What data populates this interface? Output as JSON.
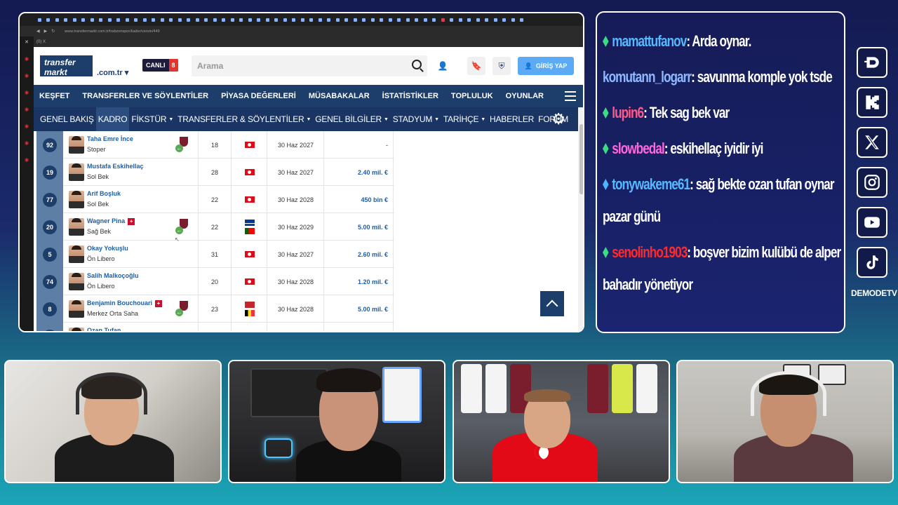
{
  "browser": {
    "url": "www.transfermarkt.com.tr/trabzonspor/kader/verein/449",
    "bookmarks_label": "(0) X",
    "site": {
      "logo_line1": "transfer",
      "logo_line2": "markt",
      "domain": ".com.tr ▾",
      "live_label": "CANLI",
      "live_count": "8",
      "search_placeholder": "Arama",
      "login_label": "GİRİŞ YAP",
      "main_nav": [
        "KEŞFET",
        "TRANSFERLER VE SÖYLENTİLER",
        "PİYASA DEĞERLERİ",
        "MÜSABAKALAR",
        "İSTATİSTİKLER",
        "TOPLULUK",
        "OYUNLAR"
      ],
      "sub_nav": [
        {
          "label": "GENEL BAKIŞ",
          "caret": false
        },
        {
          "label": "KADRO",
          "caret": false,
          "active": true
        },
        {
          "label": "FİKSTÜR",
          "caret": true
        },
        {
          "label": "TRANSFERLER & SÖYLENTİLER",
          "caret": true
        },
        {
          "label": "GENEL BİLGİLER",
          "caret": true
        },
        {
          "label": "STADYUM",
          "caret": true
        },
        {
          "label": "TARİHÇE",
          "caret": true
        },
        {
          "label": "HABERLER",
          "caret": false
        },
        {
          "label": "FORUM",
          "caret": false
        }
      ],
      "players": [
        {
          "number": "92",
          "name": "Taha Emre İnce",
          "position": "Stoper",
          "injury": false,
          "transfer": true,
          "age": "18",
          "nations": [
            "tr"
          ],
          "contract": "30 Haz 2027",
          "value": "-"
        },
        {
          "number": "19",
          "name": "Mustafa Eskihellaç",
          "position": "Sol Bek",
          "injury": false,
          "transfer": false,
          "age": "28",
          "nations": [
            "tr"
          ],
          "contract": "30 Haz 2027",
          "value": "2.40 mil. €"
        },
        {
          "number": "77",
          "name": "Arif Boşluk",
          "position": "Sol Bek",
          "injury": false,
          "transfer": false,
          "age": "22",
          "nations": [
            "tr"
          ],
          "contract": "30 Haz 2028",
          "value": "450 bin €"
        },
        {
          "number": "20",
          "name": "Wagner Pina",
          "position": "Sağ Bek",
          "injury": true,
          "transfer": true,
          "age": "22",
          "nations": [
            "cv",
            "pt"
          ],
          "contract": "30 Haz 2029",
          "value": "5.00 mil. €"
        },
        {
          "number": "5",
          "name": "Okay Yokuşlu",
          "position": "Ön Libero",
          "injury": false,
          "transfer": false,
          "age": "31",
          "nations": [
            "tr"
          ],
          "contract": "30 Haz 2027",
          "value": "2.60 mil. €"
        },
        {
          "number": "74",
          "name": "Salih Malkoçoğlu",
          "position": "Ön Libero",
          "injury": false,
          "transfer": false,
          "age": "20",
          "nations": [
            "tr"
          ],
          "contract": "30 Haz 2028",
          "value": "1.20 mil. €"
        },
        {
          "number": "8",
          "name": "Benjamin Bouchouari",
          "position": "Merkez Orta Saha",
          "injury": true,
          "transfer": true,
          "age": "23",
          "nations": [
            "ma",
            "be"
          ],
          "contract": "30 Haz 2028",
          "value": "5.00 mil. €"
        },
        {
          "number": "",
          "name": "Ozan Tufan",
          "position": "",
          "injury": false,
          "transfer": false,
          "age": "",
          "nations": [
            "tr"
          ],
          "contract": "",
          "value": ""
        }
      ]
    }
  },
  "chat": {
    "messages": [
      {
        "user": "mamattufanov",
        "user_color": "#56b9ff",
        "badge": "#3ddc84",
        "text": ": Arda oynar."
      },
      {
        "user": "komutann_logarr",
        "user_color": "#8fb8ff",
        "badge": "",
        "text": ": savunma komple yok tsde"
      },
      {
        "user": "lupin6",
        "user_color": "#ff5a8a",
        "badge": "#3ddc84",
        "text": ": Tek sag bek var"
      },
      {
        "user": "slowbedal",
        "user_color": "#ff66d9",
        "badge": "#3ddc84",
        "text": ": eskihellaç iyidir iyi"
      },
      {
        "user": "tonywakeme61",
        "user_color": "#56b9ff",
        "badge": "#4fb3ff",
        "text": ": sağ bekte ozan tufan oynar pazar günü"
      },
      {
        "user": "senolinho1903",
        "user_color": "#ff2b2b",
        "badge": "#3ddc84",
        "text": ": boşver bizim kulübü de alper bahadır yönetiyor"
      }
    ]
  },
  "social": {
    "icons": [
      "kick-d-icon",
      "kick-k-icon",
      "x-icon",
      "instagram-icon",
      "youtube-icon",
      "tiktok-icon"
    ],
    "brand": "DEMODETV"
  }
}
